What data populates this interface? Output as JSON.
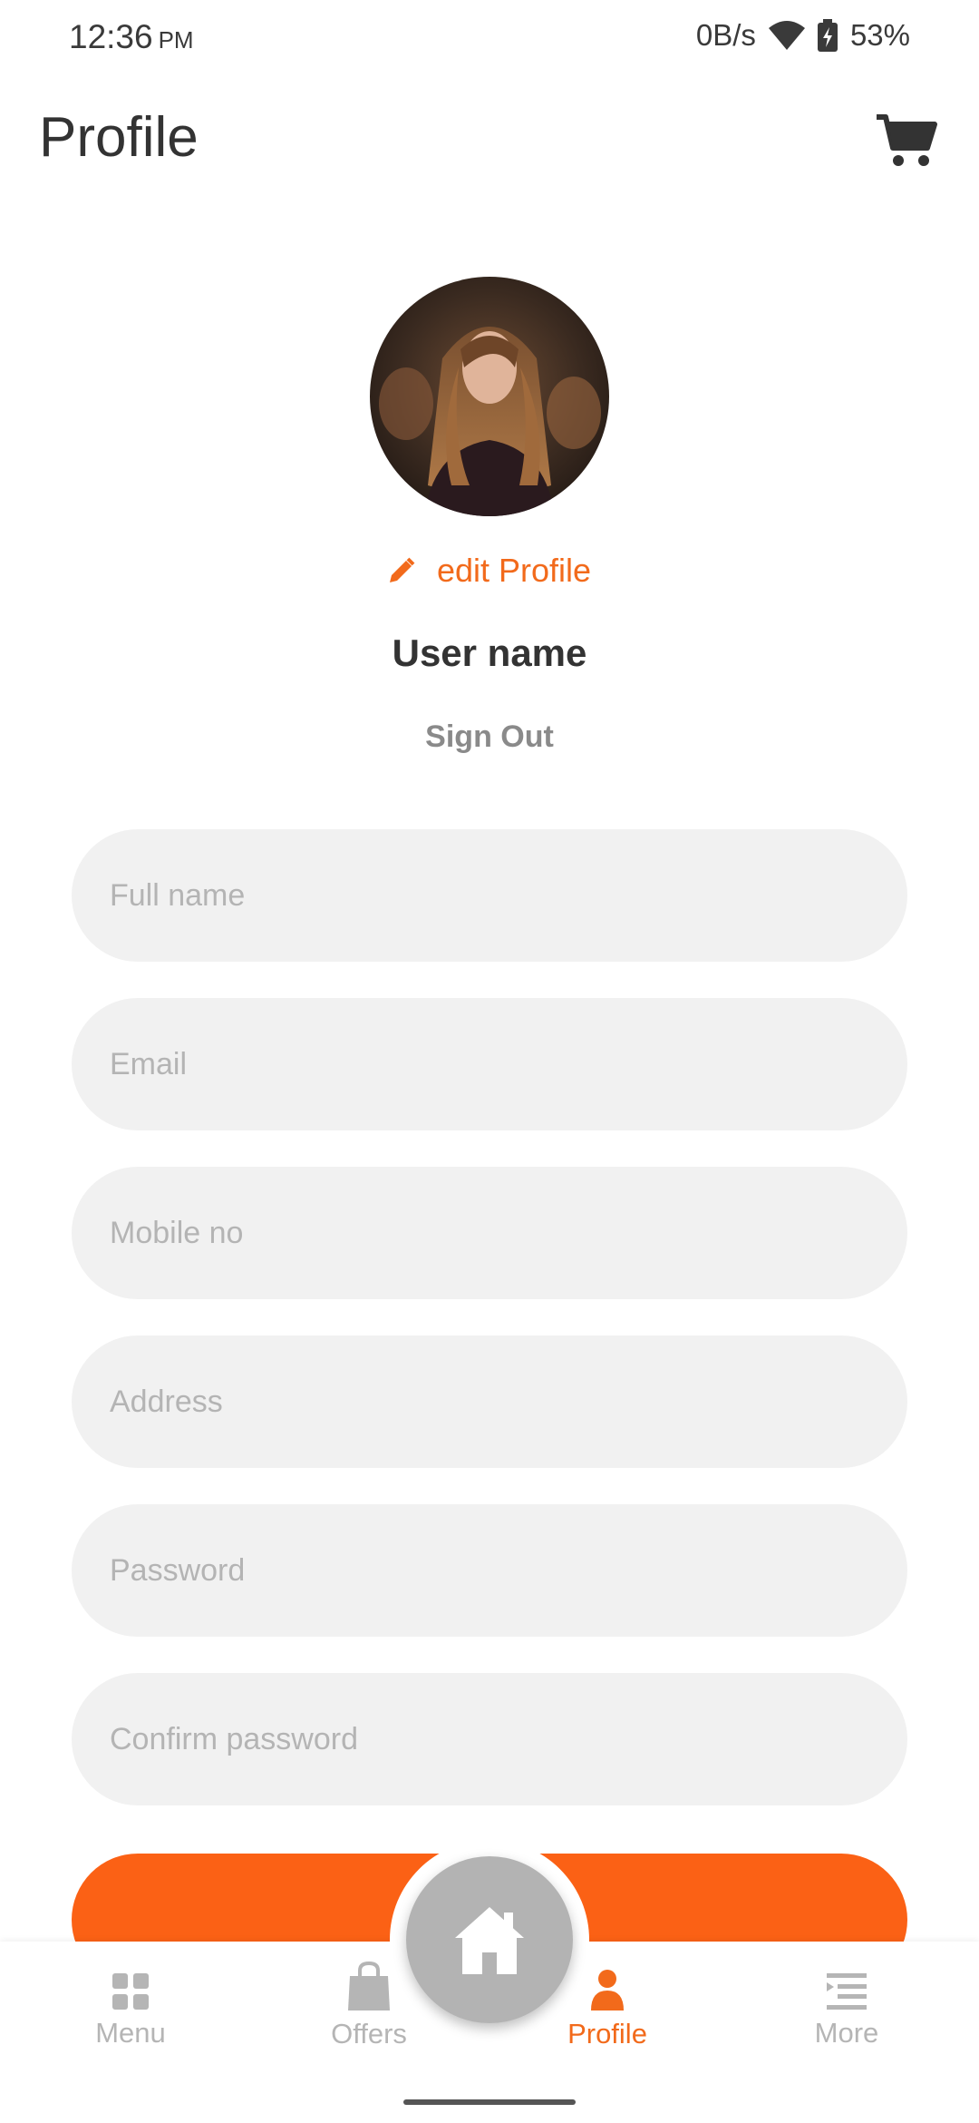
{
  "status_bar": {
    "time": "12:36",
    "ampm": "PM",
    "network_speed": "0B/s",
    "battery": "53%"
  },
  "header": {
    "title": "Profile",
    "cart_icon": "cart-icon"
  },
  "profile": {
    "edit_label": "edit Profile",
    "user_name": "User name",
    "sign_out_label": "Sign Out"
  },
  "form": {
    "full_name": {
      "value": "",
      "placeholder": "Full name"
    },
    "email": {
      "value": "",
      "placeholder": "Email"
    },
    "mobile": {
      "value": "",
      "placeholder": "Mobile no"
    },
    "address": {
      "value": "",
      "placeholder": "Address"
    },
    "password": {
      "value": "",
      "placeholder": "Password"
    },
    "confirm_password": {
      "value": "",
      "placeholder": "Confirm password"
    }
  },
  "bottom_nav": {
    "items": [
      {
        "label": "Menu",
        "icon": "grid-icon",
        "active": false
      },
      {
        "label": "Offers",
        "icon": "shopping-bag-icon",
        "active": false
      },
      {
        "label": "Profile",
        "icon": "person-icon",
        "active": true
      },
      {
        "label": "More",
        "icon": "list-icon",
        "active": false
      }
    ],
    "home_icon": "home-icon"
  },
  "colors": {
    "accent": "#fb6115",
    "field_bg": "#f1f1f1",
    "inactive": "#b5b5b5",
    "fab": "#b3b3b3"
  }
}
